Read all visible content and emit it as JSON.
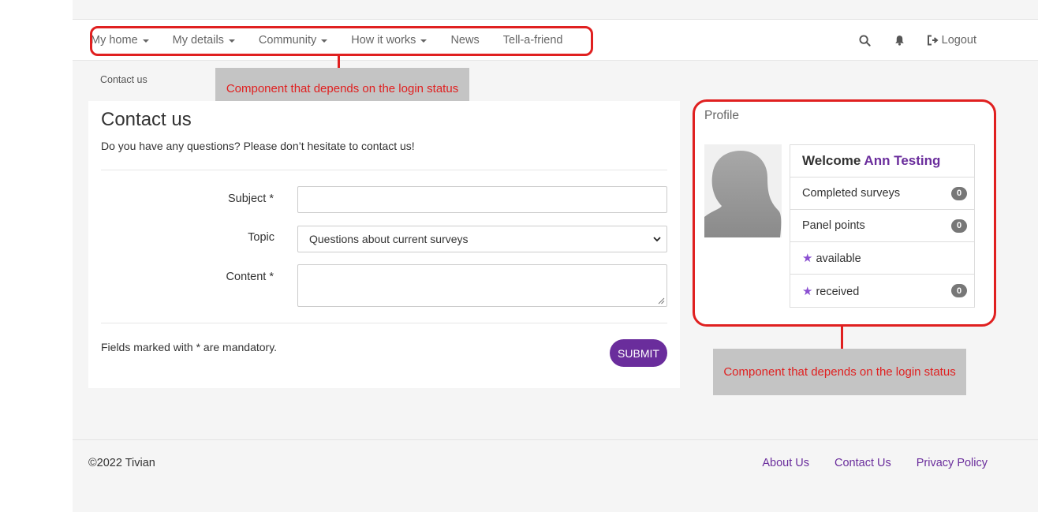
{
  "nav": {
    "items": [
      {
        "label": "My home",
        "dropdown": true
      },
      {
        "label": "My details",
        "dropdown": true
      },
      {
        "label": "Community",
        "dropdown": true
      },
      {
        "label": "How it works",
        "dropdown": true
      },
      {
        "label": "News",
        "dropdown": false
      },
      {
        "label": "Tell-a-friend",
        "dropdown": false
      }
    ],
    "search_icon": "search-icon",
    "notification_icon": "bell-icon",
    "logout_label": "Logout"
  },
  "annotations": {
    "nav_callout": "Component that depends on the login status",
    "profile_callout": "Component that depends on the login status",
    "highlight_color": "#e02020"
  },
  "breadcrumb": "Contact us",
  "contact": {
    "title": "Contact us",
    "lead": "Do you have any questions? Please don’t hesitate to contact us!",
    "subject_label": "Subject *",
    "subject_value": "",
    "topic_label": "Topic",
    "topic_value": "Questions about current surveys",
    "content_label": "Content *",
    "content_value": "",
    "mandatory_note": "Fields marked with * are mandatory.",
    "submit_label": "SUBMIT"
  },
  "profile": {
    "title": "Profile",
    "welcome_prefix": "Welcome",
    "user_name": "Ann Testing",
    "rows": [
      {
        "label": "Completed surveys",
        "count": "0",
        "star": false
      },
      {
        "label": "Panel points",
        "count": "0",
        "star": false
      },
      {
        "label": "available",
        "count": "",
        "star": true
      },
      {
        "label": "received",
        "count": "0",
        "star": true
      }
    ]
  },
  "footer": {
    "copyright": "©2022 Tivian",
    "links": [
      "About Us",
      "Contact Us",
      "Privacy Policy"
    ]
  },
  "colors": {
    "brand": "#6a2d9c",
    "badge": "#777777",
    "star": "#8a4fd1"
  }
}
